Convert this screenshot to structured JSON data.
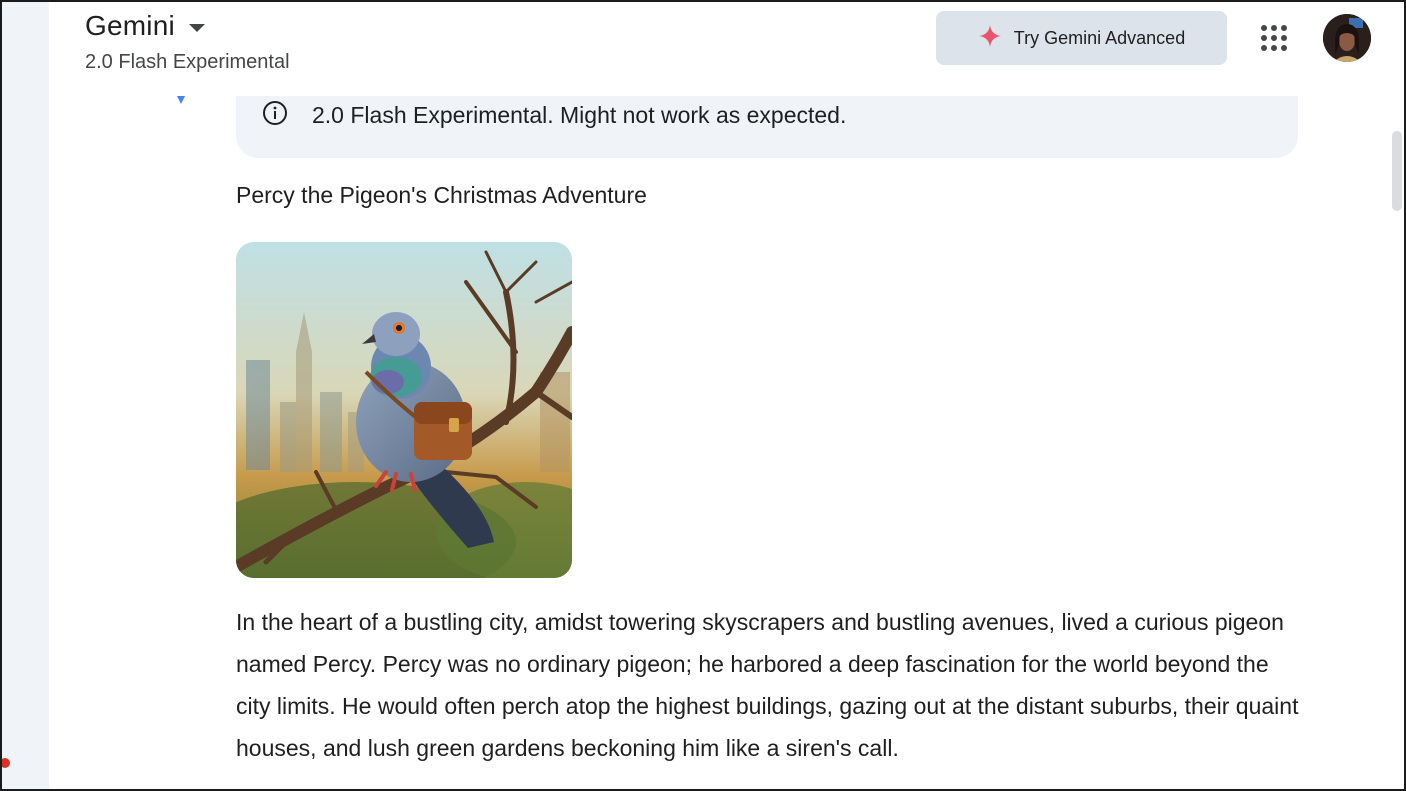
{
  "header": {
    "app_title": "Gemini",
    "model_name": "2.0 Flash Experimental",
    "try_button_label": "Try Gemini Advanced",
    "apps_icon": "apps-grid-icon",
    "avatar_icon": "user-avatar"
  },
  "banner": {
    "icon": "info-icon",
    "text": "2.0 Flash Experimental. Might not work as expected."
  },
  "story": {
    "title": "Percy the Pigeon's Christmas Adventure",
    "image_subject": "illustration of a pigeon with a leather satchel perched on a bare branch with a city skyline behind",
    "paragraph": "In the heart of a bustling city, amidst towering skyscrapers and bustling avenues, lived a curious pigeon named Percy. Percy was no ordinary pigeon; he harbored a deep fascination for the world beyond the city limits. He would often perch atop the highest buildings, gazing out at the distant suburbs, their quaint houses, and lush green gardens beckoning him like a siren's call."
  },
  "colors": {
    "accent_sparkle": "#e8556b",
    "rail_background": "#f0f4f9",
    "button_background": "#dde3ea"
  }
}
